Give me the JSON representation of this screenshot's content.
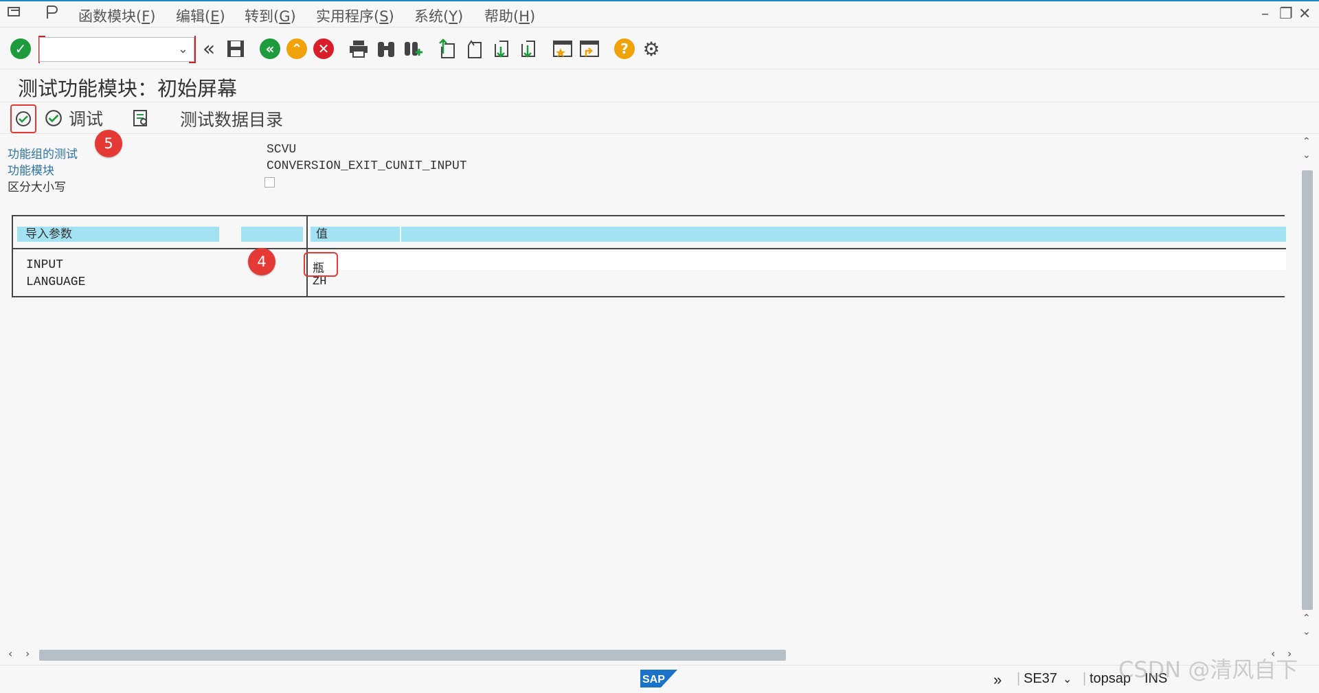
{
  "menu": {
    "items": [
      {
        "label": "函数模块(",
        "key": "F",
        "close": ")"
      },
      {
        "label": "编辑(",
        "key": "E",
        "close": ")"
      },
      {
        "label": "转到(",
        "key": "G",
        "close": ")"
      },
      {
        "label": "实用程序(",
        "key": "S",
        "close": ")"
      },
      {
        "label": "系统(",
        "key": "Y",
        "close": ")"
      },
      {
        "label": "帮助(",
        "key": "H",
        "close": ")"
      }
    ]
  },
  "window_controls": {
    "minimize": "–",
    "restore": "❐",
    "close": "✕"
  },
  "page": {
    "title": "测试功能模块：初始屏幕"
  },
  "app_toolbar": {
    "debug_label": "调试",
    "test_data_dir_label": "测试数据目录"
  },
  "badges": {
    "b5": "5",
    "b4": "4"
  },
  "form": {
    "test_group_label": "功能组的测试",
    "test_group_value": "SCVU",
    "function_module_label": "功能模块",
    "function_module_value": "CONVERSION_EXIT_CUNIT_INPUT",
    "case_sensitive_label": "区分大小写"
  },
  "params_table": {
    "header_import": "导入参数",
    "header_value": "值",
    "rows": [
      {
        "name": "INPUT",
        "value": "瓶"
      },
      {
        "name": "LANGUAGE",
        "value": "ZH"
      }
    ]
  },
  "status": {
    "transaction": "SE37",
    "server": "topsap",
    "mode": "INS",
    "logo": "SAP"
  },
  "watermark": "CSDN @清风自下",
  "colors": {
    "header_cyan": "#a3e2f2",
    "accent_red": "#e53935",
    "label_blue": "#2e73a5"
  }
}
